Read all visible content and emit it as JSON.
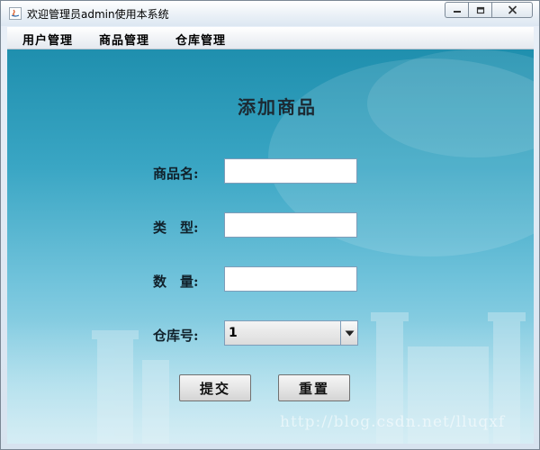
{
  "window": {
    "title": "欢迎管理员admin使用本系统"
  },
  "menubar": {
    "items": [
      {
        "label": "用户管理"
      },
      {
        "label": "商品管理"
      },
      {
        "label": "仓库管理"
      }
    ]
  },
  "form": {
    "title": "添加商品",
    "fields": {
      "name": {
        "label": "商品名:",
        "value": ""
      },
      "type": {
        "label": "类　型:",
        "value": ""
      },
      "quantity": {
        "label": "数　量:",
        "value": ""
      },
      "warehouse": {
        "label": "仓库号:",
        "selected": "1"
      }
    },
    "buttons": {
      "submit": "提交",
      "reset": "重置"
    }
  },
  "watermark": "http://blog.csdn.net/lluqxf",
  "colors": {
    "content_top": "#1f8fae",
    "content_bottom": "#bfe4ef",
    "field_border": "#7f9db9"
  }
}
